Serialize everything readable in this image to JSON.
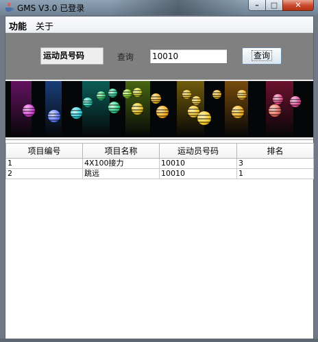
{
  "window": {
    "title": "GMS V3.0  已登录",
    "controls": {
      "minimize": "–",
      "maximize": "□",
      "close": "✕"
    }
  },
  "menubar": {
    "items": [
      "功能",
      "关于"
    ]
  },
  "query": {
    "type_label": "运动员号码",
    "query_label": "查询",
    "input_value": "10010",
    "button_label": "查询"
  },
  "table": {
    "columns": [
      "项目编号",
      "项目名称",
      "运动员号码",
      "排名"
    ],
    "rows": [
      [
        "1",
        "4X100接力",
        "10010",
        "3"
      ],
      [
        "2",
        "跳远",
        "10010",
        "1"
      ]
    ]
  },
  "colors": {
    "query_panel": "#808080",
    "banner_bg": "#050607",
    "close_button": "#c9462a"
  },
  "icons": {
    "app": "java-coffee-icon"
  }
}
